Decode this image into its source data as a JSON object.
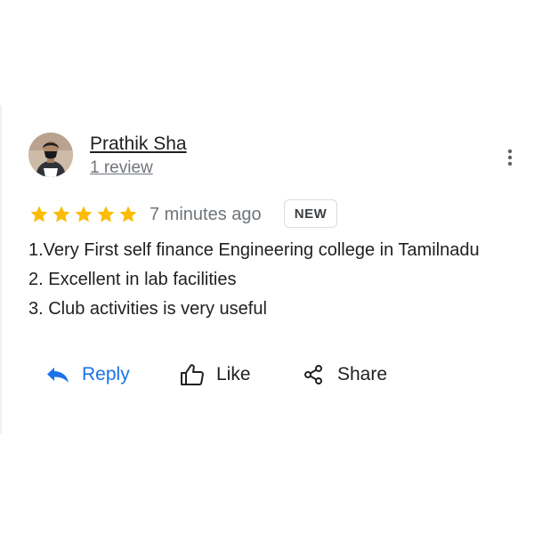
{
  "review": {
    "reviewer_name": "Prathik Sha",
    "review_count": "1 review",
    "rating": 5,
    "rating_max": 5,
    "time_ago": "7 minutes ago",
    "badge": "NEW",
    "text_lines": [
      "1.Very First self finance Engineering college in Tamilnadu",
      "2. Excellent in lab facilities",
      "3. Club activities is very useful"
    ]
  },
  "actions": {
    "reply_label": "Reply",
    "like_label": "Like",
    "share_label": "Share"
  },
  "icons": {
    "avatar": "profile-photo",
    "more": "more-vert-icon",
    "star": "star-icon",
    "reply": "reply-arrow-icon",
    "like": "thumb-up-outline-icon",
    "share": "share-nodes-icon"
  },
  "colors": {
    "star": "#fbbc04",
    "reply": "#1a73e8",
    "text": "#202124",
    "muted": "#70757a",
    "badge_border": "#dadce0"
  }
}
